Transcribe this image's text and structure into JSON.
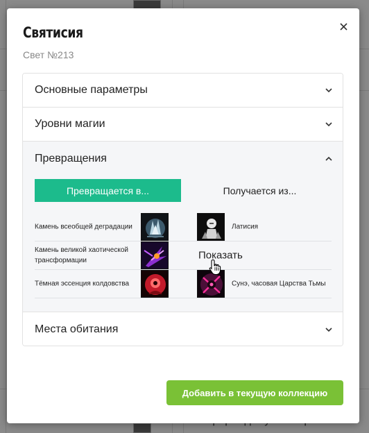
{
  "background": {
    "partial_text": "Перерожд. Рутилектра"
  },
  "modal": {
    "title": "Святисия",
    "subtitle": "Свет №213",
    "close_glyph": "×"
  },
  "sections": [
    {
      "label": "Основные параметры",
      "expanded": false
    },
    {
      "label": "Уровни магии",
      "expanded": false
    },
    {
      "label": "Превращения",
      "expanded": true
    },
    {
      "label": "Места обитания",
      "expanded": false
    }
  ],
  "transformations": {
    "tabs": {
      "active": "Превращается в...",
      "inactive": "Получается из..."
    },
    "rows": [
      {
        "left_name": "Камень всеобщей деградации",
        "left_icon": "ice-crystal-icon",
        "right_name": "Латисия",
        "right_icon": "white-creature-icon"
      },
      {
        "left_name": "Камень великой хаотической трансформации",
        "left_icon": "chaos-stone-icon",
        "right_show": "Показать"
      },
      {
        "left_name": "Тёмная эссенция колдовства",
        "left_icon": "dark-essence-icon",
        "right_name": "Сунэ, часовая Царства Тьмы",
        "right_icon": "dark-guardian-icon"
      }
    ]
  },
  "actions": {
    "add_to_collection": "Добавить в текущую коллекцию"
  },
  "colors": {
    "tab_active": "#1cbb8c",
    "add_button": "#7ac136",
    "section_open_bg": "#f5f6f8"
  }
}
